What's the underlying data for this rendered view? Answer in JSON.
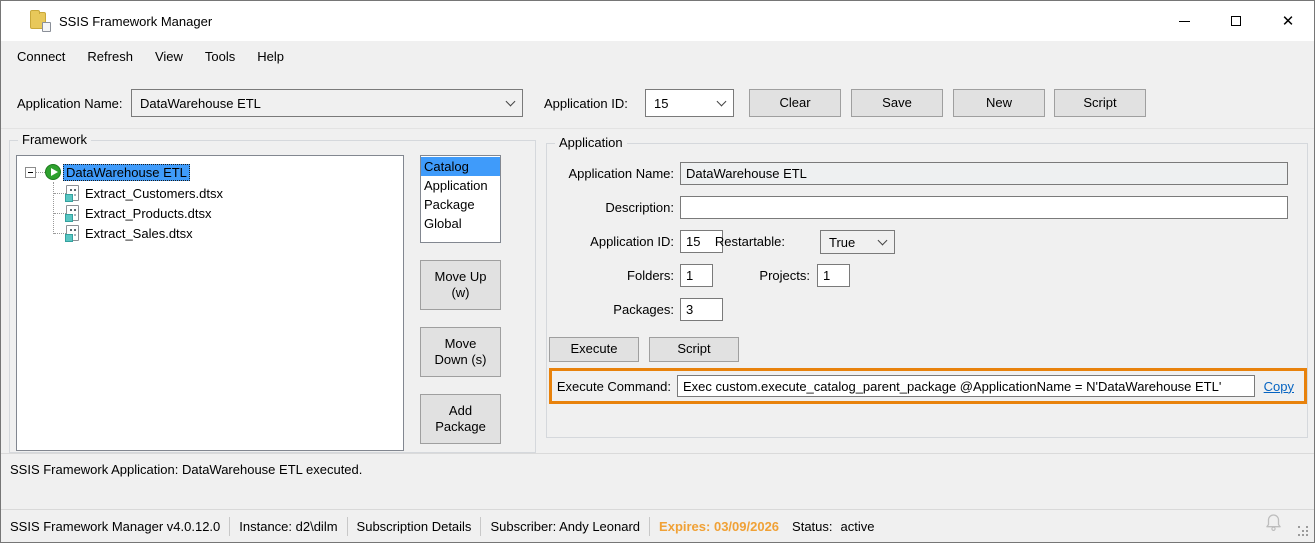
{
  "window": {
    "title": "SSIS Framework Manager"
  },
  "menu": {
    "items": [
      "Connect",
      "Refresh",
      "View",
      "Tools",
      "Help"
    ]
  },
  "toolbar": {
    "app_name_label": "Application Name:",
    "app_name_value": "DataWarehouse ETL",
    "app_id_label": "Application ID:",
    "app_id_value": "15",
    "clear_label": "Clear",
    "save_label": "Save",
    "new_label": "New",
    "script_label": "Script"
  },
  "framework": {
    "group_label": "Framework",
    "root_node": "DataWarehouse ETL",
    "packages": [
      "Extract_Customers.dtsx",
      "Extract_Products.dtsx",
      "Extract_Sales.dtsx"
    ],
    "scope_list": {
      "items": [
        "Catalog",
        "Application",
        "Package",
        "Global"
      ],
      "selected": "Catalog"
    },
    "move_up_label": "Move Up (w)",
    "move_down_label": "Move Down (s)",
    "add_package_label": "Add Package"
  },
  "application": {
    "group_label": "Application",
    "name_label": "Application Name:",
    "name_value": "DataWarehouse ETL",
    "description_label": "Description:",
    "description_value": "",
    "id_label": "Application ID:",
    "id_value": "15",
    "restartable_label": "Restartable:",
    "restartable_value": "True",
    "folders_label": "Folders:",
    "folders_value": "1",
    "projects_label": "Projects:",
    "projects_value": "1",
    "packages_label": "Packages:",
    "packages_value": "3",
    "execute_label": "Execute",
    "script_label": "Script",
    "execute_command_label": "Execute Command:",
    "execute_command_value": "Exec custom.execute_catalog_parent_package @ApplicationName = N'DataWarehouse ETL'",
    "copy_label": "Copy"
  },
  "status_message": "SSIS Framework Application: DataWarehouse ETL executed.",
  "status_bar": {
    "version": "SSIS Framework Manager v4.0.12.0",
    "instance": "Instance: d2\\dilm",
    "subscription": "Subscription Details",
    "subscriber": "Subscriber: Andy Leonard",
    "expires": "Expires: 03/09/2026",
    "status_label": "Status:",
    "status_value": "active"
  },
  "colors": {
    "selection_blue": "#3f9bfa",
    "highlight_orange": "#e8820c",
    "expires_orange": "#f0a136",
    "play_green": "#2ea12e",
    "copy_link_blue": "#0563c1"
  }
}
